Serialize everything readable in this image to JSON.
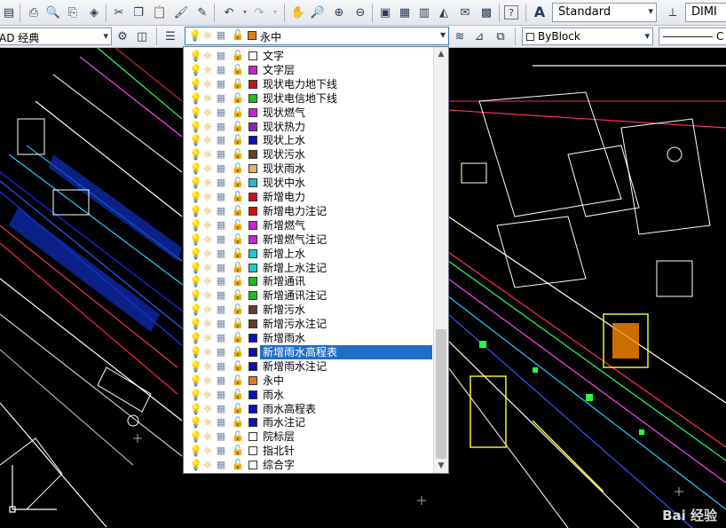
{
  "toolbar": {
    "text_style": "Standard",
    "dim_style": "DIMI",
    "workspace": "AD 经典"
  },
  "layer_control": {
    "current_layer": "永中",
    "current_color": "#e07b22",
    "linetype": "ByBlock",
    "lineweight": "C"
  },
  "layers": [
    {
      "name": "文字",
      "color": "#ffffff"
    },
    {
      "name": "文字层",
      "color": "#cc22cc"
    },
    {
      "name": "现状电力地下线",
      "color": "#d01010"
    },
    {
      "name": "现状电信地下线",
      "color": "#22bb22"
    },
    {
      "name": "现状燃气",
      "color": "#cc22cc"
    },
    {
      "name": "现状热力",
      "color": "#7b2aa8"
    },
    {
      "name": "现状上水",
      "color": "#1010b8"
    },
    {
      "name": "现状污水",
      "color": "#6b3a2a"
    },
    {
      "name": "现状雨水",
      "color": "#e8b060"
    },
    {
      "name": "现状中水",
      "color": "#22bbcc"
    },
    {
      "name": "新增电力",
      "color": "#d01010"
    },
    {
      "name": "新增电力注记",
      "color": "#d01010"
    },
    {
      "name": "新增燃气",
      "color": "#cc22cc"
    },
    {
      "name": "新增燃气注记",
      "color": "#cc22cc"
    },
    {
      "name": "新增上水",
      "color": "#22cccc"
    },
    {
      "name": "新增上水注记",
      "color": "#22cccc"
    },
    {
      "name": "新增通讯",
      "color": "#22bb22"
    },
    {
      "name": "新增通讯注记",
      "color": "#22bb22"
    },
    {
      "name": "新增污水",
      "color": "#6b3a2a"
    },
    {
      "name": "新增污水注记",
      "color": "#6b3a2a"
    },
    {
      "name": "新增雨水",
      "color": "#1010b8"
    },
    {
      "name": "新增雨水高程表",
      "color": "#1010b8",
      "selected": true
    },
    {
      "name": "新增雨水注记",
      "color": "#1010b8"
    },
    {
      "name": "永中",
      "color": "#e07b22"
    },
    {
      "name": "雨水",
      "color": "#1010b8"
    },
    {
      "name": "雨水高程表",
      "color": "#1010b8"
    },
    {
      "name": "雨水注记",
      "color": "#1010b8"
    },
    {
      "name": "院标层",
      "color": "#ffffff"
    },
    {
      "name": "指北针",
      "color": "#ffffff"
    },
    {
      "name": "综合字",
      "color": "#ffffff"
    }
  ]
}
